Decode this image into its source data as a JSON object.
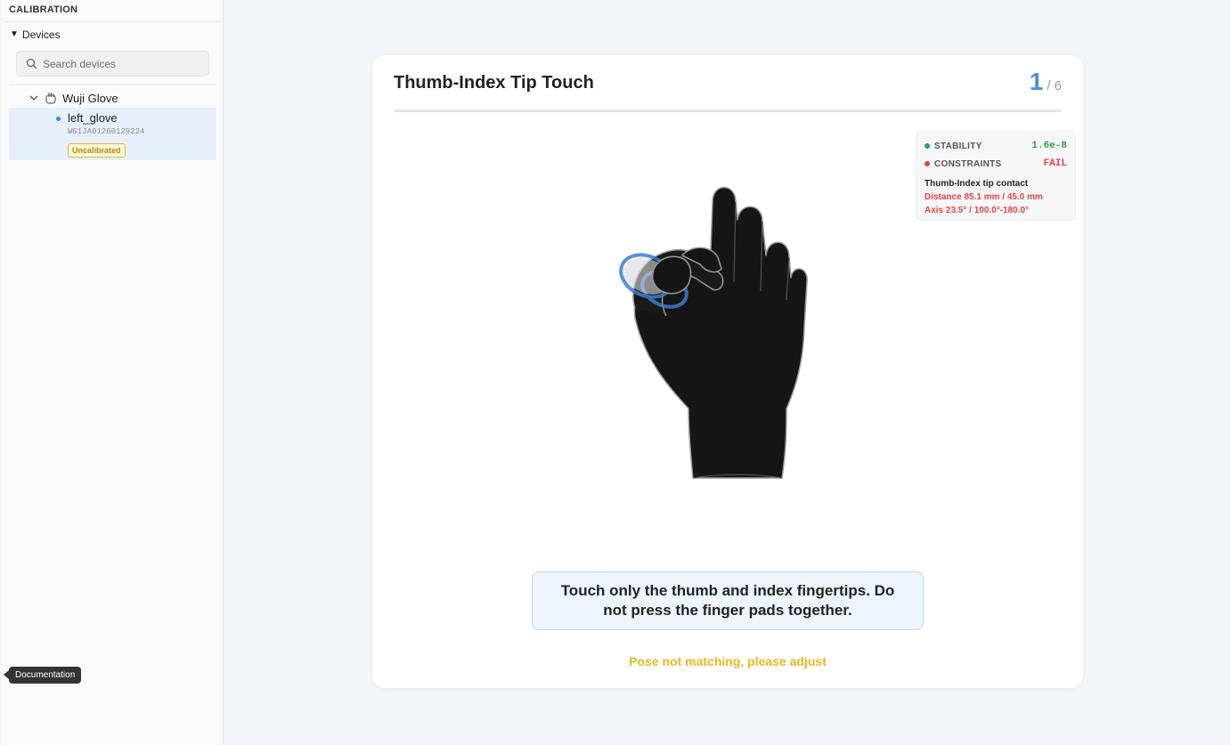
{
  "sidebar": {
    "title": "CALIBRATION",
    "devices_label": "Devices",
    "devices_caret": "▼",
    "search_placeholder": "Search devices",
    "group_name": "Wuji Glove",
    "device": {
      "name": "left_glove",
      "serial": "WG1JA01260129224",
      "status": "Uncalibrated"
    },
    "documentation_tooltip": "Documentation"
  },
  "main": {
    "title": "Thumb-Index Tip Touch",
    "step_current": "1",
    "step_total": "/ 6",
    "progress_fraction": 0,
    "metrics": {
      "stability_label": "STABILITY",
      "stability_value": "1.6e-8",
      "constraints_label": "CONSTRAINTS",
      "constraints_value": "FAIL",
      "detail_title": "Thumb-Index tip contact",
      "distance_label": "Distance 85.1 mm / 45.0 mm",
      "axis_label": "Axis 23.5° / 100.0°-180.0°"
    },
    "instruction": "Touch only the thumb and index fingertips. Do not press the finger pads together.",
    "status": "Pose not matching, please adjust"
  },
  "colors": {
    "accent": "#4a90e2",
    "ok": "#2e9e4f",
    "fail": "#e04444",
    "warn": "#e8b820"
  }
}
